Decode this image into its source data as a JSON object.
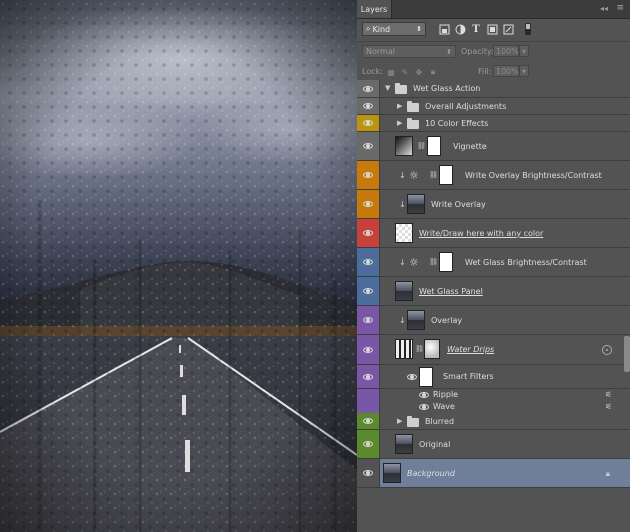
{
  "panel": {
    "tab_label": "Layers",
    "close_glyph": "◂◂",
    "menu_glyph": "≡",
    "filter": {
      "kind_label": "Kind",
      "kind_prefix": "⌕"
    },
    "blend_mode": "Normal",
    "opacity_label": "Opacity:",
    "opacity_value": "100%",
    "lock_label": "Lock:",
    "fill_label": "Fill:",
    "fill_value": "100%"
  },
  "colors": {
    "yellow": "#b8940f",
    "orange": "#c77a0b",
    "red": "#c7403a",
    "blue": "#4a6d9c",
    "violet": "#7a57a6",
    "green": "#5b8a2e",
    "gray": "#6a6a6a",
    "selected": "#6f7f99"
  },
  "icons": {
    "search": "search-icon",
    "eye": "eye-icon",
    "folder": "folder-icon",
    "chain": "chain-link-icon",
    "lock": "lock-icon",
    "fx": "smart-object-icon",
    "adjust": "brightness-contrast-icon"
  },
  "layers": [
    {
      "name": "Wet Glass Action",
      "type": "group-open",
      "color": "gray",
      "indent": 0
    },
    {
      "name": "Overall Adjustments",
      "type": "group",
      "color": "gray",
      "indent": 1
    },
    {
      "name": "10 Color Effects",
      "type": "group",
      "color": "yellow",
      "indent": 1
    },
    {
      "name": "Vignette",
      "type": "layer-mask",
      "color": "gray",
      "indent": 1
    },
    {
      "name": "Write Overlay Brightness/Contrast",
      "type": "adjust",
      "color": "orange",
      "indent": 1
    },
    {
      "name": "Write Overlay",
      "type": "image-clip",
      "color": "orange",
      "indent": 1
    },
    {
      "name": "Write/Draw here with any color",
      "type": "transparent",
      "color": "red",
      "indent": 1
    },
    {
      "name": "Wet Glass Brightness/Contrast",
      "type": "adjust",
      "color": "blue",
      "indent": 1
    },
    {
      "name": "Wet Glass Panel",
      "type": "image",
      "color": "blue",
      "indent": 1
    },
    {
      "name": "Overlay",
      "type": "image-clip",
      "color": "violet",
      "indent": 1
    },
    {
      "name": "Water Drips",
      "type": "smart",
      "color": "violet",
      "indent": 1
    },
    {
      "name": "Smart Filters",
      "type": "smart-filters",
      "color": "violet",
      "indent": 1
    },
    {
      "name": "Ripple",
      "type": "filter",
      "color": "violet",
      "indent": 1
    },
    {
      "name": "Wave",
      "type": "filter",
      "color": "violet",
      "indent": 1
    },
    {
      "name": "Blurred",
      "type": "group",
      "color": "green",
      "indent": 1
    },
    {
      "name": "Original",
      "type": "image",
      "color": "green",
      "indent": 1
    },
    {
      "name": "Background",
      "type": "background",
      "color": "selected",
      "indent": 0
    }
  ]
}
